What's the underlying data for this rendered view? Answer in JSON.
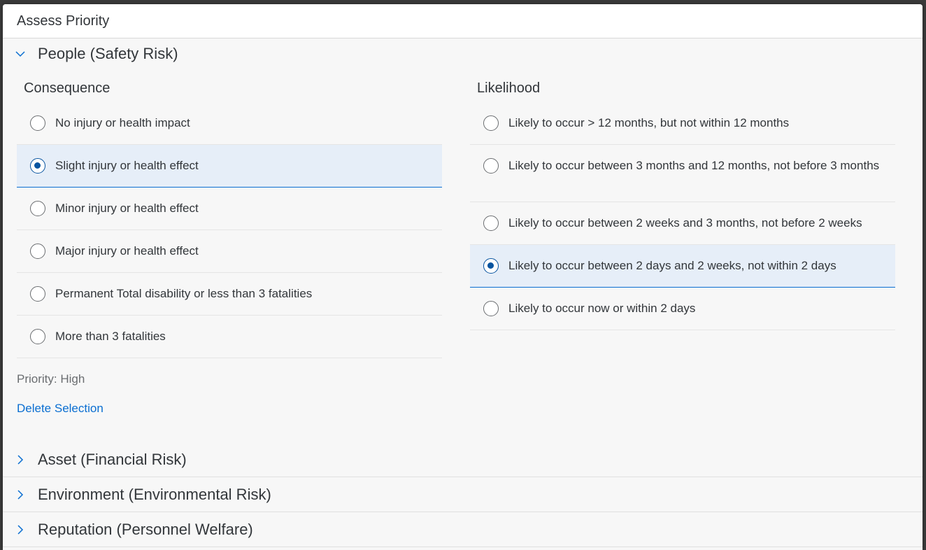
{
  "dialog": {
    "title": "Assess Priority"
  },
  "people_panel": {
    "title": "People (Safety Risk)",
    "consequence": {
      "title": "Consequence",
      "options": [
        {
          "label": "No injury or health impact",
          "selected": false
        },
        {
          "label": "Slight injury or health effect",
          "selected": true
        },
        {
          "label": "Minor injury or health effect",
          "selected": false
        },
        {
          "label": "Major injury or health effect",
          "selected": false
        },
        {
          "label": "Permanent Total disability or less than 3 fatalities",
          "selected": false
        },
        {
          "label": "More than 3 fatalities",
          "selected": false
        }
      ]
    },
    "likelihood": {
      "title": "Likelihood",
      "options": [
        {
          "label": "Likely to occur > 12 months, but not within 12 months",
          "selected": false
        },
        {
          "label": "Likely to occur between 3 months and 12 months, not before 3 months",
          "selected": false
        },
        {
          "label": "Likely to occur between 2 weeks and 3 months, not before 2 weeks",
          "selected": false
        },
        {
          "label": "Likely to occur between 2 days and 2 weeks, not within 2 days",
          "selected": true
        },
        {
          "label": "Likely to occur now or within 2 days",
          "selected": false
        }
      ]
    },
    "priority_text": "Priority: High",
    "delete_label": "Delete Selection"
  },
  "collapsed_panels": [
    {
      "title": "Asset (Financial Risk)"
    },
    {
      "title": "Environment (Environmental Risk)"
    },
    {
      "title": "Reputation (Personnel Welfare)"
    }
  ],
  "colors": {
    "accent": "#0a6ed1",
    "selected_bg": "#e6eef8",
    "radio_selected": "#0854a0"
  }
}
